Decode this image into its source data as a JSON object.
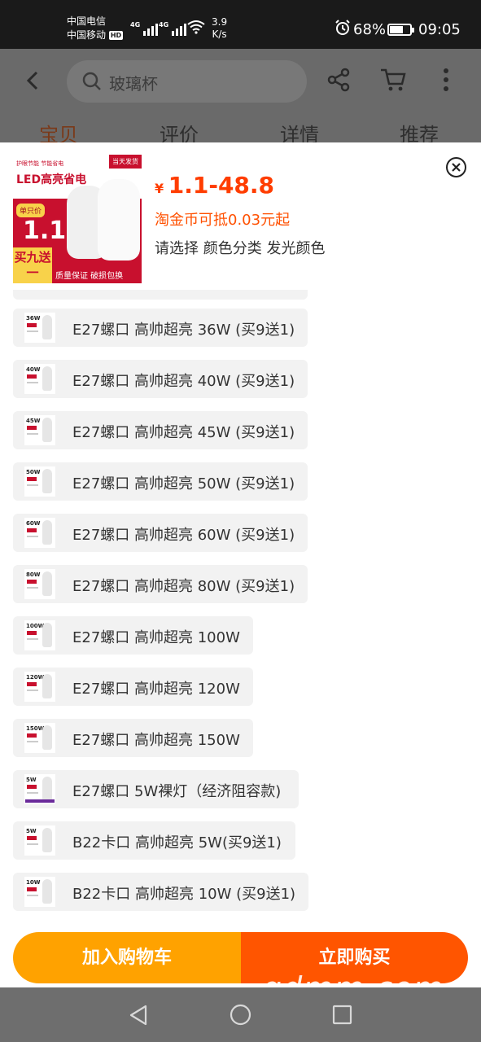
{
  "status_bar": {
    "carrier_1": "中国电信",
    "carrier_2": "中国移动",
    "hd_badge": "HD",
    "signal_1_label": "4G",
    "signal_2_label": "4G",
    "net_speed_value": "3.9",
    "net_speed_unit": "K/s",
    "battery_percent": "68%",
    "battery_level": 0.68,
    "time": "09:05"
  },
  "header": {
    "search_text": "玻璃杯",
    "tabs": [
      {
        "label": "宝贝"
      },
      {
        "label": "评价"
      },
      {
        "label": "详情"
      },
      {
        "label": "推荐"
      }
    ]
  },
  "product": {
    "image": {
      "slogan": "护眼节能 节能省电",
      "tag": "当天发货",
      "title": "LED高亮省电",
      "unit_label": "单只价",
      "price": "1.1",
      "promo": "买九送一",
      "footer": "质量保证  破损包换"
    },
    "currency": "¥",
    "price_range": "1.1-48.8",
    "coin_text": "淘金币可抵0.03元起",
    "select_text": "请选择 颜色分类 发光颜色"
  },
  "options": [
    {
      "label": "E27螺口 高帅超亮 36W (买9送1)",
      "thumb_watt": "36W"
    },
    {
      "label": "E27螺口 高帅超亮 40W (买9送1)",
      "thumb_watt": "40W"
    },
    {
      "label": "E27螺口 高帅超亮 45W (买9送1)",
      "thumb_watt": "45W"
    },
    {
      "label": "E27螺口 高帅超亮 50W (买9送1)",
      "thumb_watt": "50W"
    },
    {
      "label": "E27螺口 高帅超亮 60W (买9送1)",
      "thumb_watt": "60W"
    },
    {
      "label": "E27螺口 高帅超亮 80W (买9送1)",
      "thumb_watt": "80W"
    },
    {
      "label": "E27螺口 高帅超亮 100W",
      "thumb_watt": "100W"
    },
    {
      "label": "E27螺口 高帅超亮 120W",
      "thumb_watt": "120W"
    },
    {
      "label": "E27螺口 高帅超亮 150W",
      "thumb_watt": "150W"
    },
    {
      "label": "E27螺口 5W裸灯（经济阻容款)",
      "thumb_watt": "5W"
    },
    {
      "label": "B22卡口 高帅超亮 5W(买9送1)",
      "thumb_watt": "5W"
    },
    {
      "label": "B22卡口 高帅超亮 10W (买9送1)",
      "thumb_watt": "10W"
    }
  ],
  "actions": {
    "add_to_cart": "加入购物车",
    "buy_now": "立即购买"
  },
  "watermark": "gdmm.com",
  "colors": {
    "price": "#ff3d00",
    "add_to_cart_bg": "#ffa200",
    "buy_now_bg": "#ff5500",
    "chip_bg": "#f2f2f2"
  }
}
